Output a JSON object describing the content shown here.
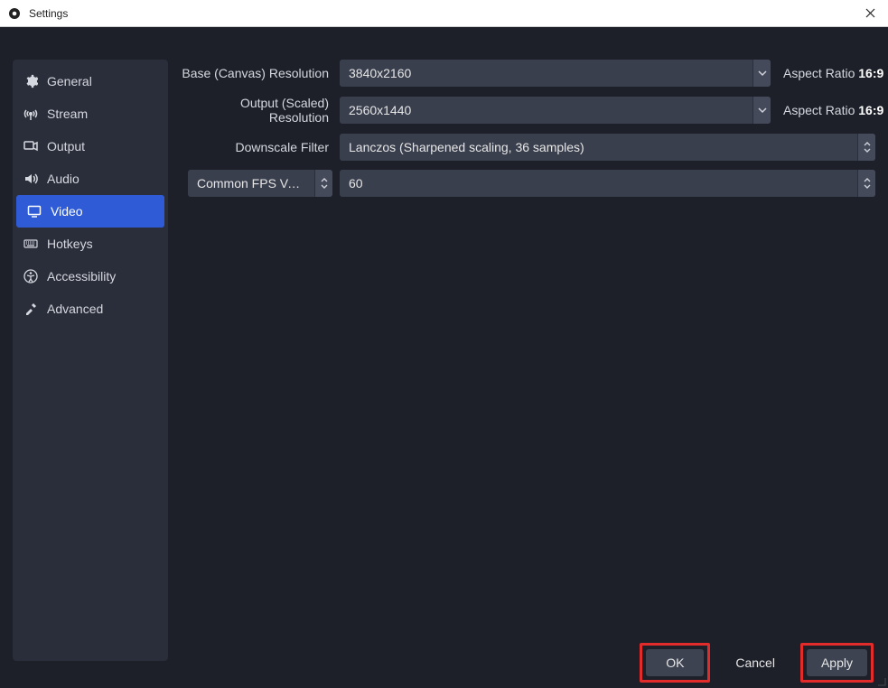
{
  "window": {
    "title": "Settings"
  },
  "sidebar": {
    "items": [
      {
        "icon": "gear-icon",
        "label": "General",
        "active": false
      },
      {
        "icon": "antenna-icon",
        "label": "Stream",
        "active": false
      },
      {
        "icon": "output-icon",
        "label": "Output",
        "active": false
      },
      {
        "icon": "speaker-icon",
        "label": "Audio",
        "active": false
      },
      {
        "icon": "monitor-icon",
        "label": "Video",
        "active": true
      },
      {
        "icon": "keyboard-icon",
        "label": "Hotkeys",
        "active": false
      },
      {
        "icon": "accessibility-icon",
        "label": "Accessibility",
        "active": false
      },
      {
        "icon": "tools-icon",
        "label": "Advanced",
        "active": false
      }
    ]
  },
  "video": {
    "base_label": "Base (Canvas) Resolution",
    "base_value": "3840x2160",
    "base_aspect_label": "Aspect Ratio",
    "base_aspect_value": "16:9",
    "output_label": "Output (Scaled) Resolution",
    "output_value": "2560x1440",
    "output_aspect_label": "Aspect Ratio",
    "output_aspect_value": "16:9",
    "downscale_label": "Downscale Filter",
    "downscale_value": "Lanczos (Sharpened scaling, 36 samples)",
    "fps_mode_label": "Common FPS Values",
    "fps_value": "60"
  },
  "footer": {
    "ok": "OK",
    "cancel": "Cancel",
    "apply": "Apply"
  }
}
